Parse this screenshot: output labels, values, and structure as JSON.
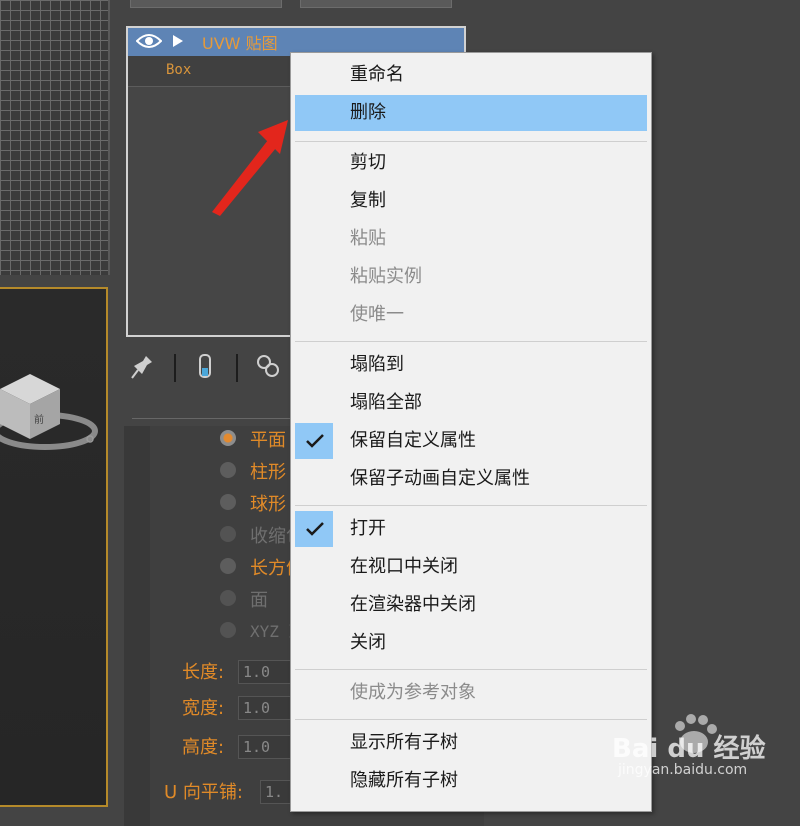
{
  "colors": {
    "accent_orange": "#e08a28",
    "selection_blue": "#5e84b5",
    "menu_highlight": "#90c8f6",
    "menu_bg": "#f1f1f1",
    "annotation_red": "#e3261c"
  },
  "modifier_stack": {
    "selected_modifier": "UVW 贴图",
    "base_object": "Box"
  },
  "params": {
    "radio_options": [
      {
        "label": "平面",
        "selected": true,
        "enabled": true
      },
      {
        "label": "柱形",
        "selected": false,
        "enabled": true
      },
      {
        "label": "球形",
        "selected": false,
        "enabled": true
      },
      {
        "label": "收缩包",
        "selected": false,
        "enabled": false
      },
      {
        "label": "长方体",
        "selected": false,
        "enabled": true
      },
      {
        "label": "面",
        "selected": false,
        "enabled": false
      },
      {
        "label": "XYZ 到",
        "selected": false,
        "enabled": false
      }
    ],
    "length_label": "长度:",
    "length_value": "1.0",
    "width_label": "宽度:",
    "width_value": "1.0",
    "height_label": "高度:",
    "height_value": "1.0",
    "u_tile_label": "U 向平铺:",
    "u_tile_value": "1."
  },
  "context_menu": {
    "items": [
      {
        "label": "重命名",
        "enabled": true
      },
      {
        "label": "删除",
        "enabled": true,
        "highlighted": true
      },
      {
        "label": "剪切",
        "enabled": true
      },
      {
        "label": "复制",
        "enabled": true
      },
      {
        "label": "粘贴",
        "enabled": false
      },
      {
        "label": "粘贴实例",
        "enabled": false
      },
      {
        "label": "使唯一",
        "enabled": false
      },
      {
        "label": "塌陷到",
        "enabled": true
      },
      {
        "label": "塌陷全部",
        "enabled": true
      },
      {
        "label": "保留自定义属性",
        "enabled": true,
        "checked": true
      },
      {
        "label": "保留子动画自定义属性",
        "enabled": true
      },
      {
        "label": "打开",
        "enabled": true,
        "checked": true
      },
      {
        "label": "在视口中关闭",
        "enabled": true
      },
      {
        "label": "在渲染器中关闭",
        "enabled": true
      },
      {
        "label": "关闭",
        "enabled": true
      },
      {
        "label": "使成为参考对象",
        "enabled": false
      },
      {
        "label": "显示所有子树",
        "enabled": true
      },
      {
        "label": "隐藏所有子树",
        "enabled": true
      }
    ]
  },
  "watermark": {
    "brand": "Bai du 经验",
    "url": "jingyan.baidu.com"
  },
  "icons": [
    "eye-icon",
    "play-arrow-icon",
    "pin-icon",
    "test-tube-icon",
    "modifier-set-icon",
    "checkmark-icon",
    "red-annotation-arrow"
  ]
}
